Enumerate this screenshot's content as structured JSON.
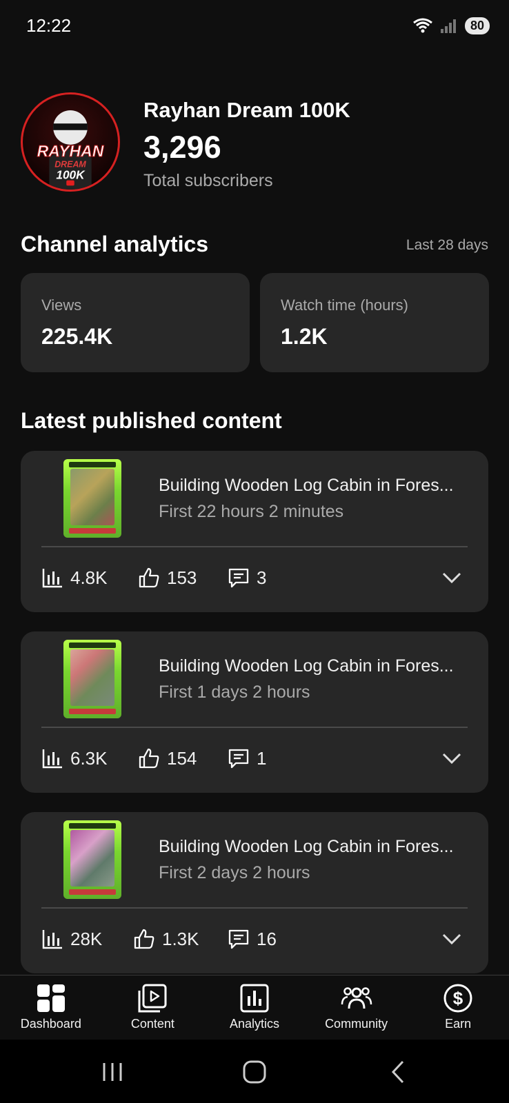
{
  "status_bar": {
    "time": "12:22",
    "battery": "80"
  },
  "channel": {
    "name": "Rayhan Dream 100K",
    "subscribers": "3,296",
    "subscribers_label": "Total subscribers",
    "avatar_text_1": "RAYHAN",
    "avatar_text_2": "DREAM",
    "avatar_text_3": "100K"
  },
  "analytics": {
    "title": "Channel analytics",
    "period": "Last 28 days",
    "metrics": [
      {
        "label": "Views",
        "value": "225.4K"
      },
      {
        "label": "Watch time (hours)",
        "value": "1.2K"
      }
    ]
  },
  "latest": {
    "title": "Latest published content",
    "videos": [
      {
        "title": "Building Wooden Log Cabin in Fores...",
        "subtitle": "First 22 hours 2 minutes",
        "views": "4.8K",
        "likes": "153",
        "comments": "3"
      },
      {
        "title": "Building Wooden Log Cabin in Fores...",
        "subtitle": "First 1 days 2 hours",
        "views": "6.3K",
        "likes": "154",
        "comments": "1"
      },
      {
        "title": "Building Wooden Log Cabin in Fores...",
        "subtitle": "First 2 days 2 hours",
        "views": "28K",
        "likes": "1.3K",
        "comments": "16"
      }
    ]
  },
  "bottom_nav": [
    {
      "label": "Dashboard",
      "icon": "dashboard-icon"
    },
    {
      "label": "Content",
      "icon": "content-icon"
    },
    {
      "label": "Analytics",
      "icon": "analytics-icon"
    },
    {
      "label": "Community",
      "icon": "community-icon"
    },
    {
      "label": "Earn",
      "icon": "earn-icon"
    }
  ]
}
